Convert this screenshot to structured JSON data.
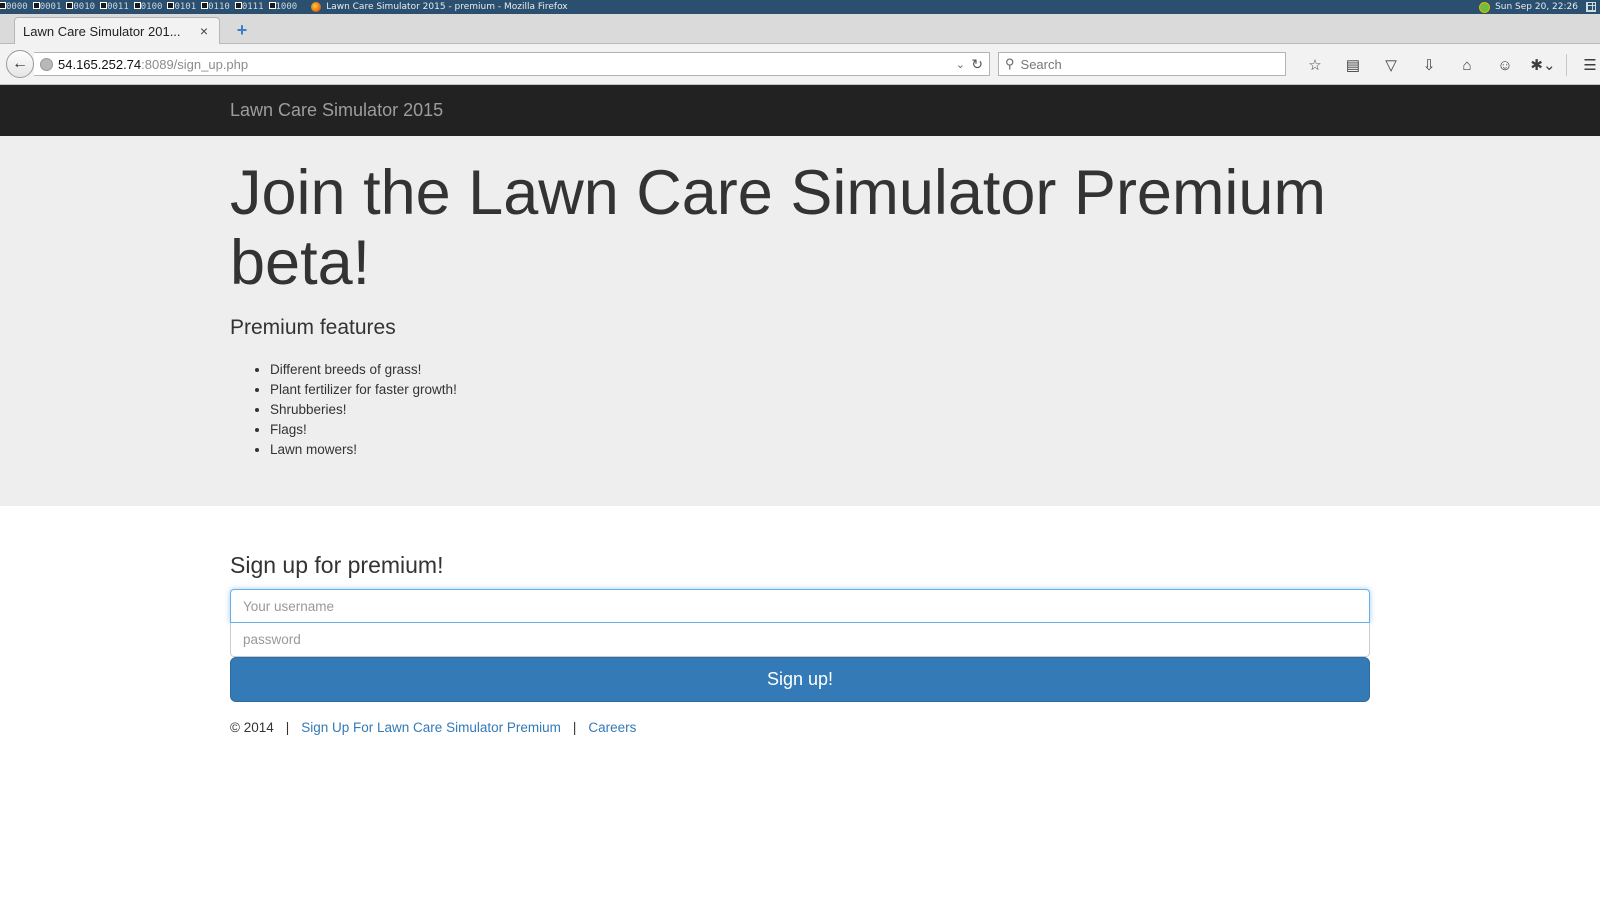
{
  "os": {
    "workspaces": [
      "0000",
      "0001",
      "0010",
      "0011",
      "0100",
      "0101",
      "0110",
      "0111",
      "1000"
    ],
    "window_title": "Lawn Care Simulator 2015 - premium - Mozilla Firefox",
    "clock": "Sun Sep 20, 22:26"
  },
  "browser": {
    "tab_title": "Lawn Care Simulator 201...",
    "tab_close": "×",
    "new_tab": "+",
    "url_host": "54.165.252.74",
    "url_rest": ":8089/sign_up.php",
    "search_placeholder": "Search",
    "toolbar_icons": [
      "bookmark-star-icon",
      "reading-list-icon",
      "pocket-icon",
      "download-icon",
      "home-icon",
      "chat-icon",
      "extension-icon",
      "menu-icon"
    ]
  },
  "site": {
    "brand": "Lawn Care Simulator 2015",
    "heading": "Join the Lawn Care Simulator Premium beta!",
    "features_title": "Premium features",
    "features": [
      "Different breeds of grass!",
      "Plant fertilizer for faster growth!",
      "Shrubberies!",
      "Flags!",
      "Lawn mowers!"
    ],
    "form": {
      "title": "Sign up for premium!",
      "username_placeholder": "Your username",
      "password_placeholder": "password",
      "submit_label": "Sign up!"
    },
    "footer": {
      "copyright": "© 2014",
      "link_signup": "Sign Up For Lawn Care Simulator Premium",
      "link_careers": "Careers"
    }
  },
  "colors": {
    "navbar_bg": "#222222",
    "jumbotron_bg": "#eeeeee",
    "primary": "#337ab7",
    "link": "#337ab7"
  }
}
